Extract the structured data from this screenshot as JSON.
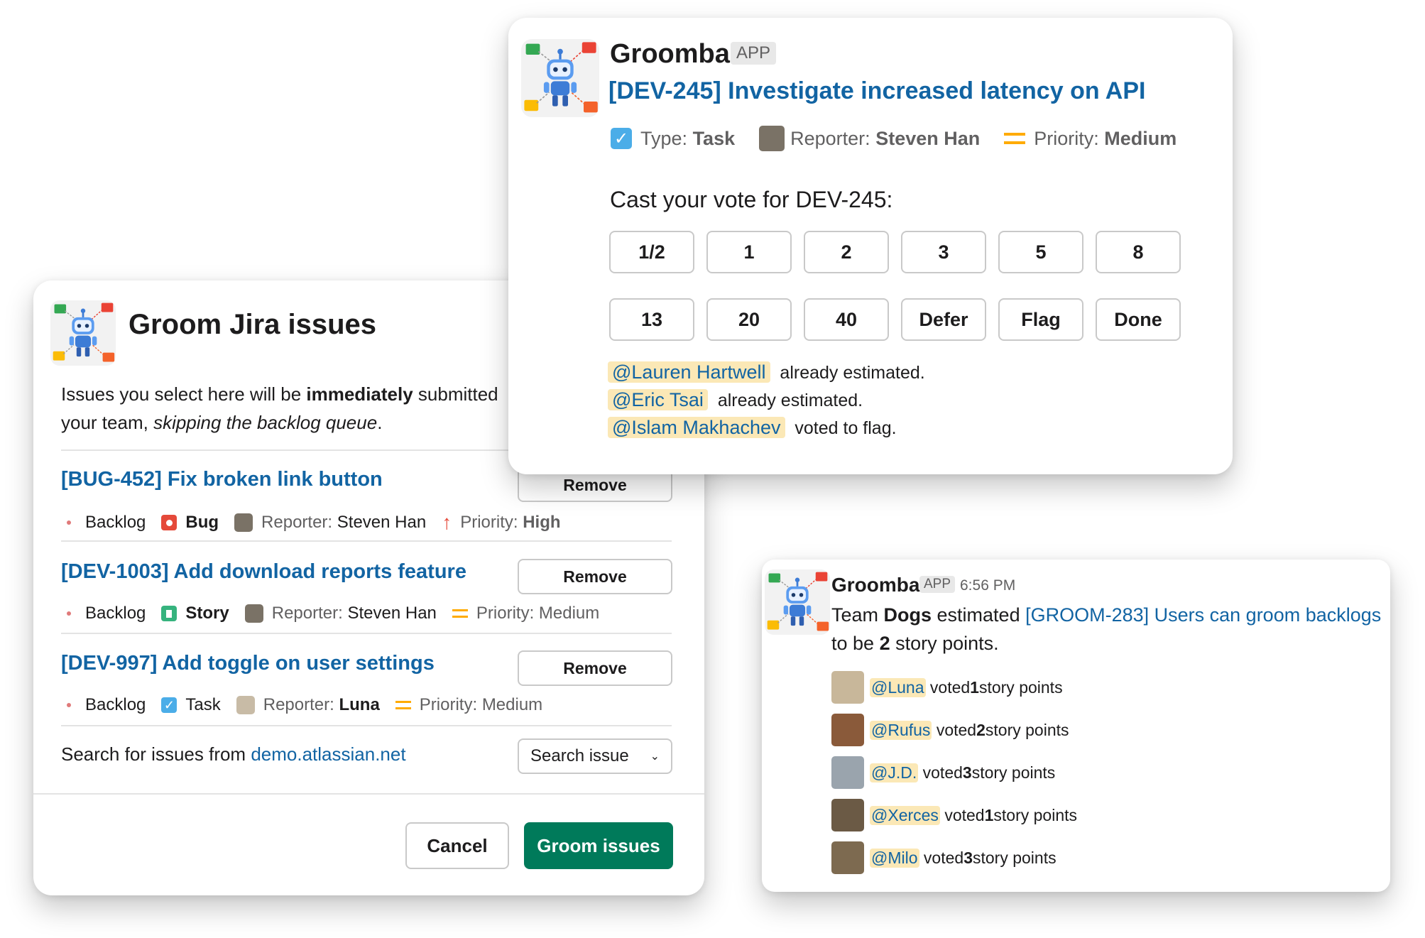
{
  "groom_dialog": {
    "title": "Groom Jira issues",
    "intro_part1": "Issues you select here will be ",
    "intro_bold": "immediately",
    "intro_part2": " submitted",
    "intro_line2_part1": "your team, ",
    "intro_line2_italic": "skipping the backlog queue",
    "intro_line2_part2": ".",
    "issues": [
      {
        "title": "[BUG-452] Fix broken link button",
        "remove_label": "Remove",
        "status": "Backlog",
        "type": "Bug",
        "type_icon": "bug-icon",
        "reporter_label": "Reporter:",
        "reporter": "Steven Han",
        "priority_label": "Priority:",
        "priority": "High",
        "priority_icon": "priority-high-icon"
      },
      {
        "title": "[DEV-1003] Add download reports feature",
        "remove_label": "Remove",
        "status": "Backlog",
        "type": "Story",
        "type_icon": "story-icon",
        "reporter_label": "Reporter:",
        "reporter": "Steven Han",
        "priority_label": "Priority:",
        "priority": "Medium",
        "priority_icon": "priority-medium-icon"
      },
      {
        "title": "[DEV-997] Add toggle on user settings",
        "remove_label": "Remove",
        "status": "Backlog",
        "type": "Task",
        "type_icon": "task-icon",
        "reporter_label": "Reporter:",
        "reporter": "Luna",
        "priority_label": "Priority:",
        "priority": "Medium",
        "priority_icon": "priority-medium-icon"
      }
    ],
    "search_text": "Search for issues from ",
    "search_domain": "demo.atlassian.net",
    "search_select": "Search issue",
    "cancel_label": "Cancel",
    "groom_label": "Groom issues",
    "colors": {
      "accent": "#007a5a",
      "link": "#1264a3"
    }
  },
  "vote_message": {
    "app_name": "Groomba",
    "app_badge": "APP",
    "issue_title": "[DEV-245] Investigate increased latency on API",
    "type_label": "Type:",
    "type": "Task",
    "reporter_label": "Reporter:",
    "reporter": "Steven Han",
    "priority_label": "Priority:",
    "priority": "Medium",
    "prompt": "Cast your vote for DEV-245:",
    "votes_row1": [
      "1/2",
      "1",
      "2",
      "3",
      "5",
      "8"
    ],
    "votes_row2": [
      "13",
      "20",
      "40",
      "Defer",
      "Flag",
      "Done"
    ],
    "activity": [
      {
        "user": "@Lauren Hartwell",
        "text": "already estimated."
      },
      {
        "user": "@Eric Tsai",
        "text": "already estimated."
      },
      {
        "user": "@Islam Makhachev",
        "text": "voted to flag."
      }
    ]
  },
  "result_message": {
    "app_name": "Groomba",
    "app_badge": "APP",
    "time": "6:56 PM",
    "line1_a": "Team ",
    "line1_team": "Dogs",
    "line1_b": " estimated ",
    "line1_link": "[GROOM-283] Users can groom backlogs",
    "line2_a": "to be ",
    "line2_points": "2",
    "line2_b": " story points.",
    "votes": [
      {
        "user": "@Luna",
        "pre": "voted ",
        "points": "1",
        "post": " story points",
        "avatar_color": "#c8b79a"
      },
      {
        "user": "@Rufus",
        "pre": "voted ",
        "points": "2",
        "post": " story points",
        "avatar_color": "#8a5a3a"
      },
      {
        "user": "@J.D.",
        "pre": "voted ",
        "points": "3",
        "post": " story points",
        "avatar_color": "#9aa4ad"
      },
      {
        "user": "@Xerces",
        "pre": "voted ",
        "points": "1",
        "post": " story points",
        "avatar_color": "#6b5a45"
      },
      {
        "user": "@Milo",
        "pre": "voted ",
        "points": "3",
        "post": " story points",
        "avatar_color": "#7d6a50"
      }
    ]
  }
}
